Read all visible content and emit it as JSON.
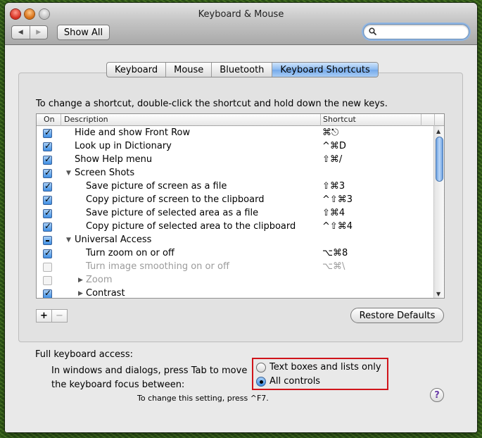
{
  "window": {
    "title": "Keyboard & Mouse"
  },
  "toolbar": {
    "back_glyph": "◀",
    "forward_glyph": "▶",
    "show_all_label": "Show All",
    "search_placeholder": ""
  },
  "tabs": [
    {
      "label": "Keyboard",
      "selected": false
    },
    {
      "label": "Mouse",
      "selected": false
    },
    {
      "label": "Bluetooth",
      "selected": false
    },
    {
      "label": "Keyboard Shortcuts",
      "selected": true
    }
  ],
  "instruction": "To change a shortcut, double-click the shortcut and hold down the new keys.",
  "table": {
    "headers": {
      "on": "On",
      "description": "Description",
      "shortcut": "Shortcut"
    },
    "rows": [
      {
        "state": "checked",
        "indent": "l1",
        "description": "Hide and show Front Row",
        "shortcut": "⌘⎋",
        "disclosure": ""
      },
      {
        "state": "checked",
        "indent": "l1",
        "description": "Look up in Dictionary",
        "shortcut": "^⌘D",
        "disclosure": ""
      },
      {
        "state": "checked",
        "indent": "l1",
        "description": "Show Help menu",
        "shortcut": "⇧⌘/",
        "disclosure": ""
      },
      {
        "state": "checked",
        "indent": "g0",
        "description": "Screen Shots",
        "shortcut": "",
        "disclosure": "open"
      },
      {
        "state": "checked",
        "indent": "l2",
        "description": "Save picture of screen as a file",
        "shortcut": "⇧⌘3",
        "disclosure": ""
      },
      {
        "state": "checked",
        "indent": "l2",
        "description": "Copy picture of screen to the clipboard",
        "shortcut": "^⇧⌘3",
        "disclosure": ""
      },
      {
        "state": "checked",
        "indent": "l2",
        "description": "Save picture of selected area as a file",
        "shortcut": "⇧⌘4",
        "disclosure": ""
      },
      {
        "state": "checked",
        "indent": "l2",
        "description": "Copy picture of selected area to the clipboard",
        "shortcut": "^⇧⌘4",
        "disclosure": ""
      },
      {
        "state": "mixed",
        "indent": "g0",
        "description": "Universal Access",
        "shortcut": "",
        "disclosure": "open"
      },
      {
        "state": "checked",
        "indent": "l2",
        "description": "Turn zoom on or off",
        "shortcut": "⌥⌘8",
        "disclosure": ""
      },
      {
        "state": "disabled",
        "indent": "l2",
        "description": "Turn image smoothing on or off",
        "shortcut": "⌥⌘\\",
        "disclosure": "",
        "gray": true
      },
      {
        "state": "disabled",
        "indent": "g1",
        "description": "Zoom",
        "shortcut": "",
        "disclosure": "closed",
        "gray": true
      },
      {
        "state": "checked",
        "indent": "g1",
        "description": "Contrast",
        "shortcut": "",
        "disclosure": "closed"
      }
    ]
  },
  "buttons": {
    "add": "+",
    "remove": "−",
    "restore_defaults": "Restore Defaults"
  },
  "full_keyboard_access": {
    "label": "Full keyboard access:",
    "description_line1": "In windows and dialogs, press Tab to move",
    "description_line2": "the keyboard focus between:",
    "options": [
      {
        "label": "Text boxes and lists only",
        "selected": false
      },
      {
        "label": "All controls",
        "selected": true
      }
    ],
    "hint": "To change this setting, press ^F7."
  },
  "help_glyph": "?",
  "colors": {
    "highlight_box": "#d0141a",
    "selected_tab": "#8bbaf0"
  }
}
